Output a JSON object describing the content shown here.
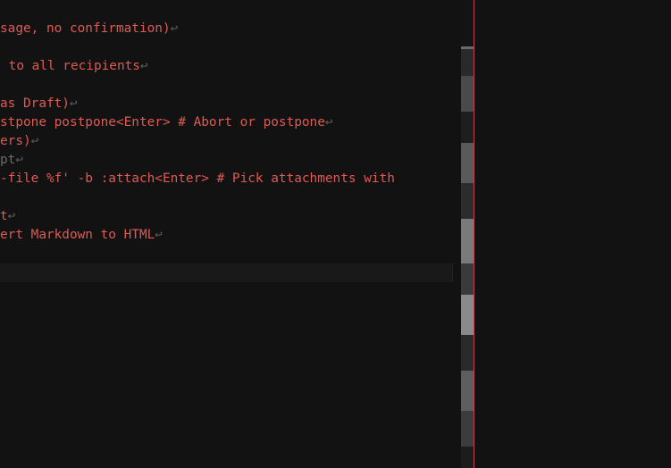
{
  "editor": {
    "eol_symbol": "↩",
    "lines": [
      {
        "text": "sage, no confirmation)",
        "dim": false,
        "eol": true
      },
      {
        "text": "",
        "dim": false,
        "eol": false
      },
      {
        "text": " to all recipients",
        "dim": false,
        "eol": true
      },
      {
        "text": "",
        "dim": false,
        "eol": false
      },
      {
        "text": "as Draft)",
        "dim": false,
        "eol": true
      },
      {
        "text": "stpone postpone<Enter> # Abort or postpone",
        "dim": false,
        "eol": true
      },
      {
        "text": "ers)",
        "dim": false,
        "eol": true
      },
      {
        "text": "pt",
        "dim": true,
        "eol": true
      },
      {
        "text": "-file %f' -b :attach<Enter> # Pick attachments with",
        "dim": false,
        "eol": false
      },
      {
        "text": "",
        "dim": false,
        "eol": false
      },
      {
        "text": "t",
        "dim": false,
        "eol": true
      },
      {
        "text": "ert Markdown to HTML",
        "dim": false,
        "eol": true
      }
    ]
  },
  "colors": {
    "background": "#121212",
    "text": "#dd5a55",
    "eol": "#5a5a5a",
    "cursorline": "#191919",
    "divider": "#c0454b"
  }
}
